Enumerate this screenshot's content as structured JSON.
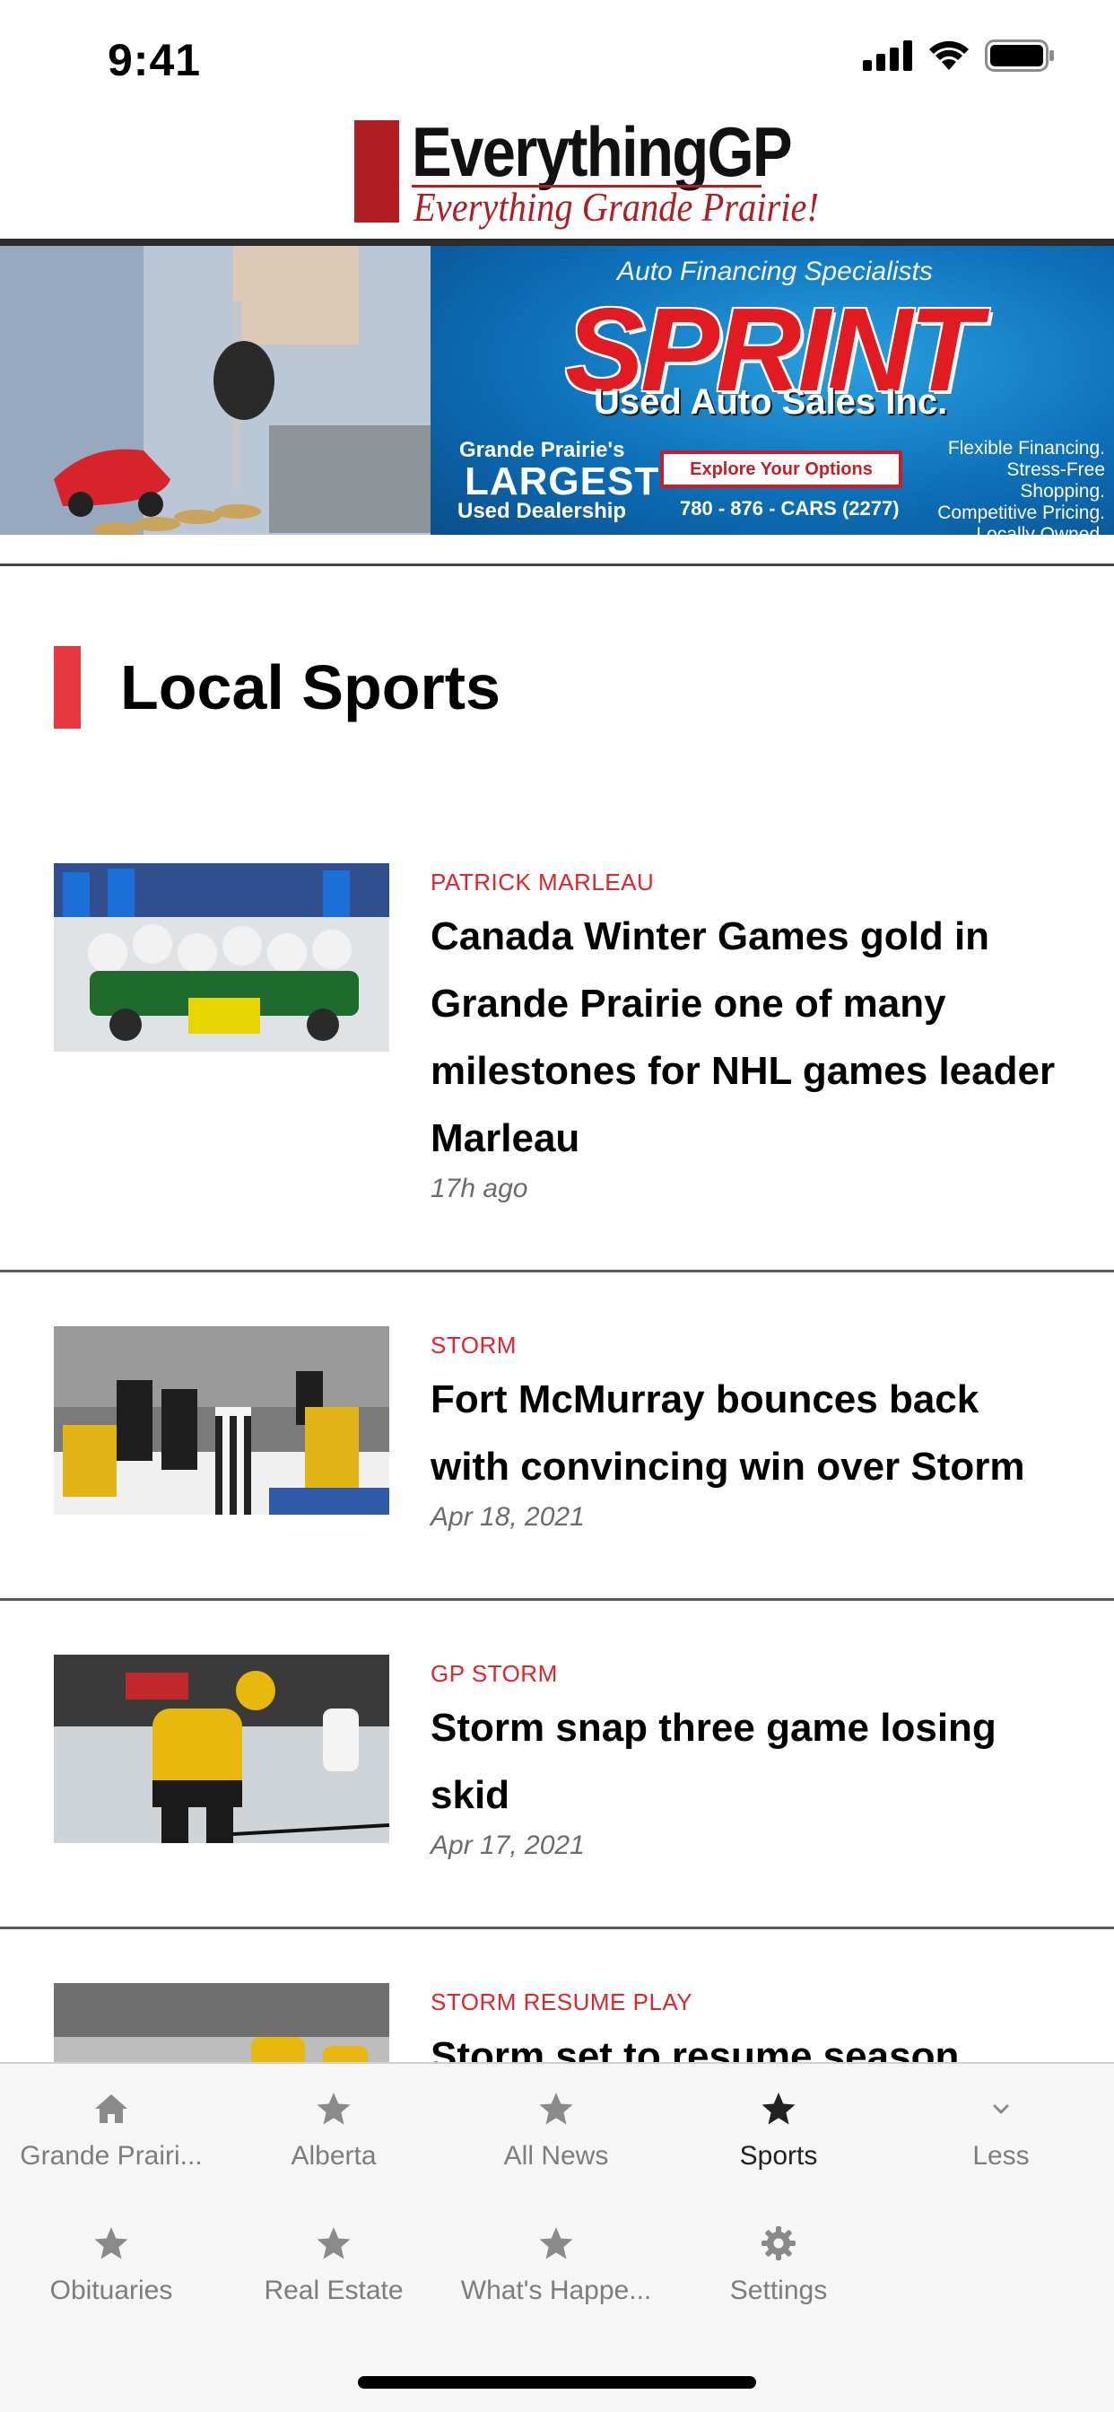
{
  "status_bar": {
    "time": "9:41"
  },
  "header": {
    "logo_main": "EverythingGP",
    "logo_sub": "Everything Grande Prairie!"
  },
  "banner_ad": {
    "tagline": "Auto Financing Specialists",
    "brand": "SPRINT",
    "company": "Used Auto Sales Inc.",
    "claim_line1": "Grande Prairie's",
    "claim_line2": "LARGEST",
    "claim_line3": "Used Dealership",
    "button_label": "Explore Your Options",
    "phone": "780 - 876 - CARS (2277)",
    "features": "Flexible Financing. Stress-Free Shopping. Competitive Pricing. Locally Owned."
  },
  "section": {
    "title": "Local Sports"
  },
  "articles": [
    {
      "category": "PATRICK MARLEAU",
      "title": "Canada Winter Games gold in Grande Prairie one of many milestones for NHL games leader Marleau",
      "time": "17h ago"
    },
    {
      "category": "STORM",
      "title": "Fort McMurray bounces back with convincing win over Storm",
      "time": "Apr 18, 2021"
    },
    {
      "category": "GP STORM",
      "title": "Storm snap three game losing skid",
      "time": "Apr 17, 2021"
    },
    {
      "category": "STORM RESUME PLAY",
      "title": "Storm set to resume season",
      "time": ""
    }
  ],
  "tabbar": {
    "tabs": [
      {
        "label": "Grande Prairi...",
        "icon": "home-icon"
      },
      {
        "label": "Alberta",
        "icon": "star-icon"
      },
      {
        "label": "All News",
        "icon": "star-icon"
      },
      {
        "label": "Sports",
        "icon": "star-icon",
        "active": true
      },
      {
        "label": "Less",
        "icon": "chevron-down-icon"
      },
      {
        "label": "Obituaries",
        "icon": "star-icon"
      },
      {
        "label": "Real Estate",
        "icon": "star-icon"
      },
      {
        "label": "What's Happe...",
        "icon": "star-icon"
      },
      {
        "label": "Settings",
        "icon": "gear-icon"
      }
    ]
  },
  "colors": {
    "accent_red": "#e0252c",
    "section_marker": "#e8383f",
    "tab_inactive": "#7d7d7d",
    "tab_active": "#222222"
  }
}
